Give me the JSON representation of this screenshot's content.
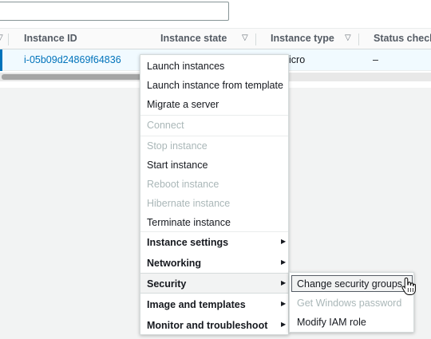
{
  "table": {
    "headers": {
      "instance_id": "Instance ID",
      "instance_state": "Instance state",
      "instance_type": "Instance type",
      "status_check": "Status check"
    },
    "row": {
      "instance_id": "i-05b09d24869f64836",
      "instance_type_partial": "icro",
      "status_check": "–"
    }
  },
  "menu": {
    "items": [
      {
        "label": "Launch instances",
        "disabled": false
      },
      {
        "label": "Launch instance from template",
        "disabled": false
      },
      {
        "label": "Migrate a server",
        "disabled": false
      },
      {
        "label": "Connect",
        "disabled": true
      },
      {
        "label": "Stop instance",
        "disabled": true
      },
      {
        "label": "Start instance",
        "disabled": false
      },
      {
        "label": "Reboot instance",
        "disabled": true
      },
      {
        "label": "Hibernate instance",
        "disabled": true
      },
      {
        "label": "Terminate instance",
        "disabled": false
      },
      {
        "label": "Instance settings",
        "disabled": false,
        "submenu": true
      },
      {
        "label": "Networking",
        "disabled": false,
        "submenu": true
      },
      {
        "label": "Security",
        "disabled": false,
        "submenu": true,
        "highlighted": true
      },
      {
        "label": "Image and templates",
        "disabled": false,
        "submenu": true
      },
      {
        "label": "Monitor and troubleshoot",
        "disabled": false,
        "submenu": true
      }
    ]
  },
  "submenu": {
    "items": [
      {
        "label": "Change security groups",
        "disabled": false,
        "hovered": true
      },
      {
        "label": "Get Windows password",
        "disabled": true
      },
      {
        "label": "Modify IAM role",
        "disabled": false
      }
    ]
  },
  "icons": {
    "sort": "sort-caret-icon",
    "submenu_arrow": "submenu-arrow-icon",
    "cursor": "hand-pointer-icon"
  },
  "colors": {
    "link": "#0073bb",
    "disabled": "#aab7b8",
    "selected_row": "#f1faff"
  }
}
